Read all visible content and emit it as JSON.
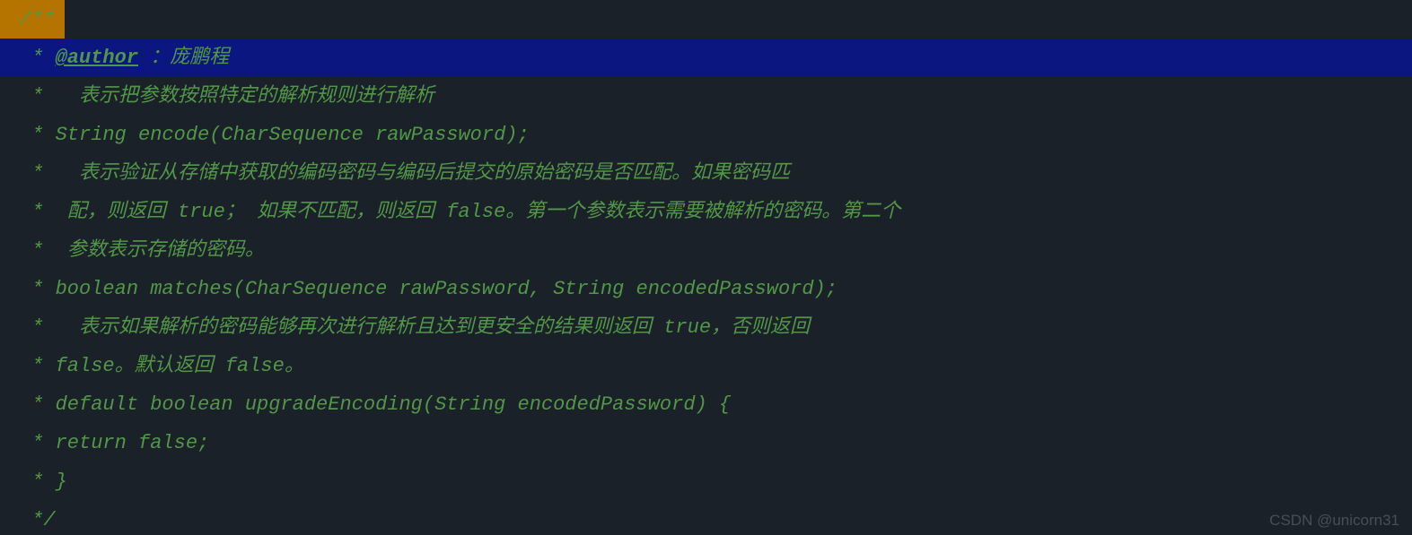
{
  "code": {
    "line1": "/**",
    "line2_star": " * ",
    "line2_tag": "@author",
    "line2_rest": " ：庞鹏程",
    "line3": " *   表示把参数按照特定的解析规则进行解析",
    "line4": " * String encode(CharSequence rawPassword);",
    "line5": " *   表示验证从存储中获取的编码密码与编码后提交的原始密码是否匹配。如果密码匹",
    "line6": " *  配，则返回 true； 如果不匹配，则返回 false。第一个参数表示需要被解析的密码。第二个",
    "line7": " *  参数表示存储的密码。",
    "line8": " * boolean matches(CharSequence rawPassword, String encodedPassword);",
    "line9": " *   表示如果解析的密码能够再次进行解析且达到更安全的结果则返回 true，否则返回",
    "line10": " * false。默认返回 false。",
    "line11": " * default boolean upgradeEncoding(String encodedPassword) {",
    "line12": " * return false;",
    "line13": " * }",
    "line14": " */"
  },
  "watermark": "CSDN @unicorn31"
}
